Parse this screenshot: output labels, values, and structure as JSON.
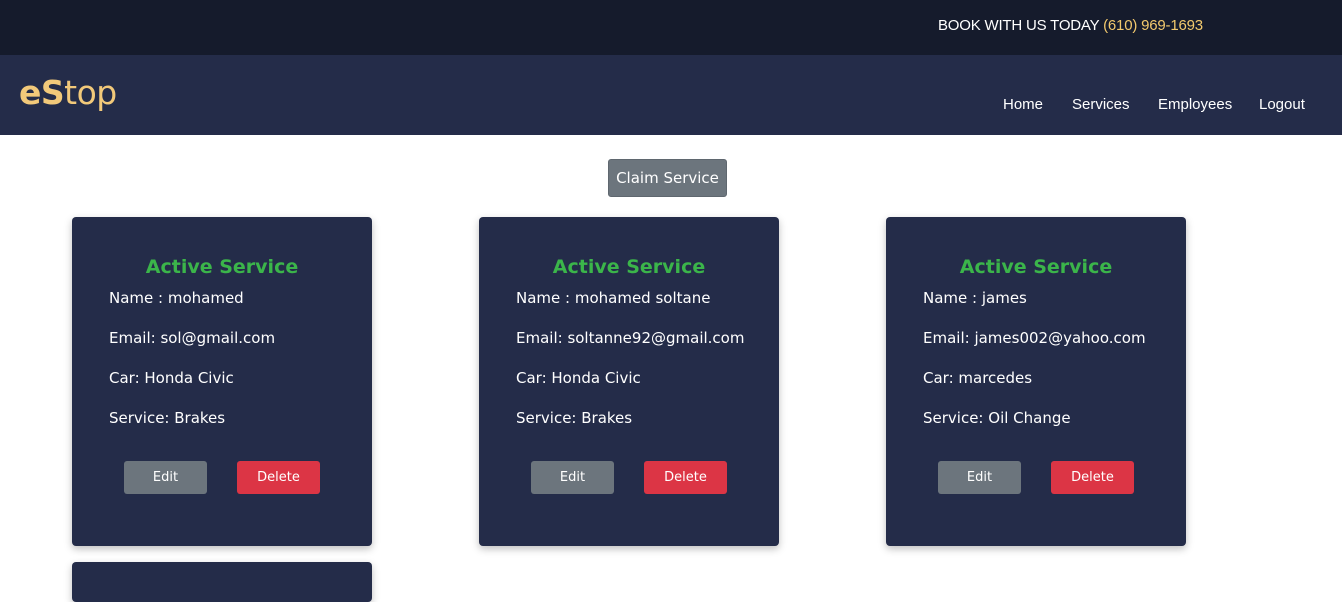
{
  "topbar": {
    "book_text": "BOOK WITH US TODAY ",
    "phone": "(610) 969-1693"
  },
  "brand": {
    "logo_bold": "eS",
    "logo_rest": "top"
  },
  "nav": {
    "home": "Home",
    "services": "Services",
    "employees": "Employees",
    "logout": "Logout"
  },
  "claim_button": "Claim Service",
  "cards": [
    {
      "title": "Active Service",
      "name": "Name : mohamed",
      "email": "Email: sol@gmail.com",
      "car": "Car: Honda Civic",
      "service": "Service: Brakes",
      "edit": "Edit",
      "delete": "Delete"
    },
    {
      "title": "Active Service",
      "name": "Name : mohamed soltane",
      "email": "Email: soltanne92@gmail.com",
      "car": "Car: Honda Civic",
      "service": "Service: Brakes",
      "edit": "Edit",
      "delete": "Delete"
    },
    {
      "title": "Active Service",
      "name": "Name : james",
      "email": "Email: james002@yahoo.com",
      "car": "Car: marcedes",
      "service": "Service: Oil Change",
      "edit": "Edit",
      "delete": "Delete"
    }
  ],
  "colors": {
    "topbar": "#151b2c",
    "navbar": "#242c49",
    "card": "#242c49",
    "accent": "#f2c96d",
    "active_title": "#3bb54a",
    "edit": "#6c757d",
    "delete": "#dc3545"
  }
}
